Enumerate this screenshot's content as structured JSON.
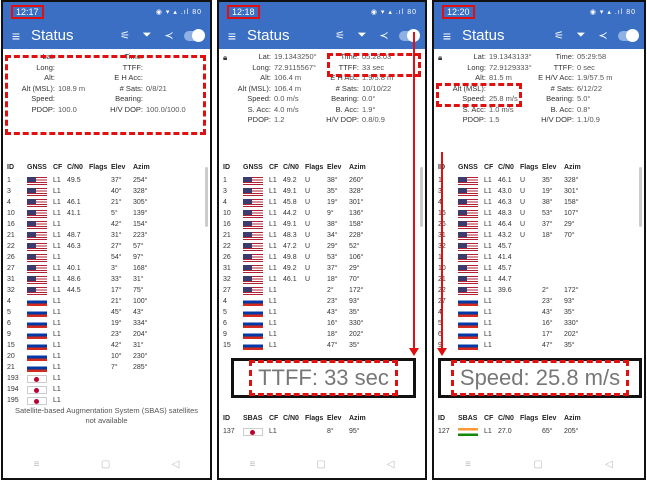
{
  "colors": {
    "accent": "#3a6fc4",
    "highlight": "#e01010"
  },
  "phones": [
    {
      "time": "12:17",
      "status_icons": "◉ ▾ ▴ .ıl 80",
      "title": "Status",
      "info": [
        {
          "lk": "Lat:",
          "lv": "",
          "rk": "Time:",
          "rv": ""
        },
        {
          "lk": "Long:",
          "lv": "",
          "rk": "TTFF:",
          "rv": ""
        },
        {
          "lk": "Alt:",
          "lv": "",
          "rk": "E H Acc:",
          "rv": ""
        },
        {
          "lk": "Alt (MSL):",
          "lv": "108.9 m",
          "rk": "# Sats:",
          "rv": "0/8/21"
        },
        {
          "lk": "Speed:",
          "lv": "",
          "rk": "Bearing:",
          "rv": ""
        },
        {
          "lk": "PDOP:",
          "lv": "100.0",
          "rk": "H/V DOP:",
          "rv": "100.0/100.0"
        }
      ],
      "headers": [
        "ID",
        "GNSS",
        "CF",
        "C/N0",
        "Flags",
        "Elev",
        "Azim"
      ],
      "rows": [
        [
          "1",
          "us",
          "L1",
          "49.5",
          "",
          "37°",
          "254°"
        ],
        [
          "3",
          "us",
          "L1",
          "",
          "",
          "40°",
          "328°"
        ],
        [
          "4",
          "us",
          "L1",
          "46.1",
          "",
          "21°",
          "305°"
        ],
        [
          "10",
          "us",
          "L1",
          "41.1",
          "",
          "5°",
          "139°"
        ],
        [
          "16",
          "us",
          "L1",
          "",
          "",
          "42°",
          "154°"
        ],
        [
          "21",
          "us",
          "L1",
          "48.7",
          "",
          "31°",
          "223°"
        ],
        [
          "22",
          "us",
          "L1",
          "46.3",
          "",
          "27°",
          "57°"
        ],
        [
          "26",
          "us",
          "L1",
          "",
          "",
          "54°",
          "97°"
        ],
        [
          "27",
          "us",
          "L1",
          "40.1",
          "",
          "3°",
          "168°"
        ],
        [
          "31",
          "us",
          "L1",
          "48.6",
          "",
          "33°",
          "31°"
        ],
        [
          "32",
          "us",
          "L1",
          "44.5",
          "",
          "17°",
          "75°"
        ],
        [
          "4",
          "ru",
          "L1",
          "",
          "",
          "21°",
          "100°"
        ],
        [
          "5",
          "ru",
          "L1",
          "",
          "",
          "45°",
          "43°"
        ],
        [
          "6",
          "ru",
          "L1",
          "",
          "",
          "19°",
          "334°"
        ],
        [
          "9",
          "ru",
          "L1",
          "",
          "",
          "23°",
          "204°"
        ],
        [
          "15",
          "ru",
          "L1",
          "",
          "",
          "42°",
          "31°"
        ],
        [
          "20",
          "ru",
          "L1",
          "",
          "",
          "10°",
          "230°"
        ],
        [
          "21",
          "ru",
          "L1",
          "",
          "",
          "7°",
          "285°"
        ],
        [
          "193",
          "jp",
          "L1",
          "",
          "",
          "",
          ""
        ],
        [
          "194",
          "jp",
          "L1",
          "",
          "",
          "",
          ""
        ],
        [
          "195",
          "jp",
          "L1",
          "",
          "",
          "",
          ""
        ]
      ],
      "sbas_note": "Satellite-based Augmentation System (SBAS) satellites not available"
    },
    {
      "time": "12:18",
      "status_icons": "◉ ▾ ▴ .ıl 80",
      "title": "Status",
      "info": [
        {
          "lk": "Lat:",
          "lv": "19.1343250°",
          "rk": "Time:",
          "rv": "05:28:03"
        },
        {
          "lk": "Long:",
          "lv": "72.9115567°",
          "rk": "TTFF:",
          "rv": "33 sec"
        },
        {
          "lk": "Alt:",
          "lv": "106.4 m",
          "rk": "E H Acc:",
          "rv": "1.9/5.8 m"
        },
        {
          "lk": "Alt (MSL):",
          "lv": "106.4 m",
          "rk": "# Sats:",
          "rv": "10/10/22"
        },
        {
          "lk": "Speed:",
          "lv": "0.0 m/s",
          "rk": "Bearing:",
          "rv": "0.0°"
        },
        {
          "lk": "S. Acc:",
          "lv": "4.0 m/s",
          "rk": "B. Acc:",
          "rv": "1.9°"
        },
        {
          "lk": "PDOP:",
          "lv": "1.2",
          "rk": "H/V DOP:",
          "rv": "0.8/0.9"
        }
      ],
      "headers": [
        "ID",
        "GNSS",
        "CF",
        "C/N0",
        "Flags",
        "Elev",
        "Azim"
      ],
      "rows": [
        [
          "1",
          "us",
          "L1",
          "49.2",
          "U",
          "38°",
          "260°"
        ],
        [
          "3",
          "us",
          "L1",
          "49.1",
          "U",
          "35°",
          "328°"
        ],
        [
          "4",
          "us",
          "L1",
          "45.8",
          "U",
          "19°",
          "301°"
        ],
        [
          "10",
          "us",
          "L1",
          "44.2",
          "U",
          "9°",
          "136°"
        ],
        [
          "16",
          "us",
          "L1",
          "49.1",
          "U",
          "38°",
          "158°"
        ],
        [
          "21",
          "us",
          "L1",
          "48.3",
          "U",
          "34°",
          "228°"
        ],
        [
          "22",
          "us",
          "L1",
          "47.2",
          "U",
          "29°",
          "52°"
        ],
        [
          "26",
          "us",
          "L1",
          "49.8",
          "U",
          "53°",
          "106°"
        ],
        [
          "31",
          "us",
          "L1",
          "49.2",
          "U",
          "37°",
          "29°"
        ],
        [
          "32",
          "us",
          "L1",
          "46.1",
          "U",
          "18°",
          "70°"
        ],
        [
          "27",
          "us",
          "L1",
          "",
          "",
          "2°",
          "172°"
        ],
        [
          "4",
          "ru",
          "L1",
          "",
          "",
          "23°",
          "93°"
        ],
        [
          "5",
          "ru",
          "L1",
          "",
          "",
          "43°",
          "35°"
        ],
        [
          "6",
          "ru",
          "L1",
          "",
          "",
          "16°",
          "330°"
        ],
        [
          "9",
          "ru",
          "L1",
          "",
          "",
          "18°",
          "202°"
        ],
        [
          "15",
          "ru",
          "L1",
          "",
          "",
          "47°",
          "35°"
        ]
      ],
      "zoom_text": "TTFF:  33 sec",
      "sbas_headers": [
        "ID",
        "SBAS",
        "CF",
        "C/N0",
        "Flags",
        "Elev",
        "Azim"
      ],
      "sbas_row": [
        "137",
        "jp",
        "L1",
        "",
        "",
        "8°",
        "95°"
      ]
    },
    {
      "time": "12:20",
      "status_icons": "◉ ▾ ▴ .ıl 80",
      "title": "Status",
      "info": [
        {
          "lk": "Lat:",
          "lv": "19.1343133°",
          "rk": "Time:",
          "rv": "05:29:58"
        },
        {
          "lk": "Long:",
          "lv": "72.9129333°",
          "rk": "TTFF:",
          "rv": "0 sec"
        },
        {
          "lk": "Alt:",
          "lv": "81.5 m",
          "rk": "E H/V Acc:",
          "rv": "1.9/57.5 m"
        },
        {
          "lk": "Alt (MSL):",
          "lv": "",
          "rk": "# Sats:",
          "rv": "6/12/22"
        },
        {
          "lk": "Speed:",
          "lv": "25.8 m/s",
          "rk": "Bearing:",
          "rv": "5.0°"
        },
        {
          "lk": "S. Acc:",
          "lv": "1.0 m/s",
          "rk": "B. Acc:",
          "rv": "0.8°"
        },
        {
          "lk": "PDOP:",
          "lv": "1.5",
          "rk": "H/V DOP:",
          "rv": "1.1/0.9"
        }
      ],
      "headers": [
        "ID",
        "GNSS",
        "CF",
        "C/N0",
        "Flags",
        "Elev",
        "Azim"
      ],
      "rows": [
        [
          "1",
          "us",
          "L1",
          "46.1",
          "U",
          "35°",
          "328°"
        ],
        [
          "3",
          "us",
          "L1",
          "43.0",
          "U",
          "19°",
          "301°"
        ],
        [
          "4",
          "us",
          "L1",
          "46.3",
          "U",
          "38°",
          "158°"
        ],
        [
          "16",
          "us",
          "L1",
          "48.3",
          "U",
          "53°",
          "107°"
        ],
        [
          "26",
          "us",
          "L1",
          "46.4",
          "U",
          "37°",
          "29°"
        ],
        [
          "31",
          "us",
          "L1",
          "43.2",
          "U",
          "18°",
          "70°"
        ],
        [
          "32",
          "us",
          "L1",
          "45.7",
          "",
          "",
          ""
        ],
        [
          "1",
          "us",
          "L1",
          "41.4",
          "",
          "",
          ""
        ],
        [
          "10",
          "us",
          "L1",
          "45.7",
          "",
          "",
          ""
        ],
        [
          "21",
          "us",
          "L1",
          "44.7",
          "",
          "",
          ""
        ],
        [
          "22",
          "us",
          "L1",
          "39.6",
          "",
          "2°",
          "172°"
        ],
        [
          "27",
          "ru",
          "L1",
          "",
          "",
          "23°",
          "93°"
        ],
        [
          "4",
          "ru",
          "L1",
          "",
          "",
          "43°",
          "35°"
        ],
        [
          "5",
          "ru",
          "L1",
          "",
          "",
          "16°",
          "330°"
        ],
        [
          "6",
          "ru",
          "L1",
          "",
          "",
          "17°",
          "202°"
        ],
        [
          "9",
          "ru",
          "L1",
          "",
          "",
          "47°",
          "35°"
        ]
      ],
      "zoom_text": "Speed:  25.8 m/s",
      "sbas_headers": [
        "ID",
        "SBAS",
        "CF",
        "C/N0",
        "Flags",
        "Elev",
        "Azim"
      ],
      "sbas_row": [
        "127",
        "in",
        "L1",
        "27.0",
        "",
        "65°",
        "205°"
      ]
    }
  ]
}
